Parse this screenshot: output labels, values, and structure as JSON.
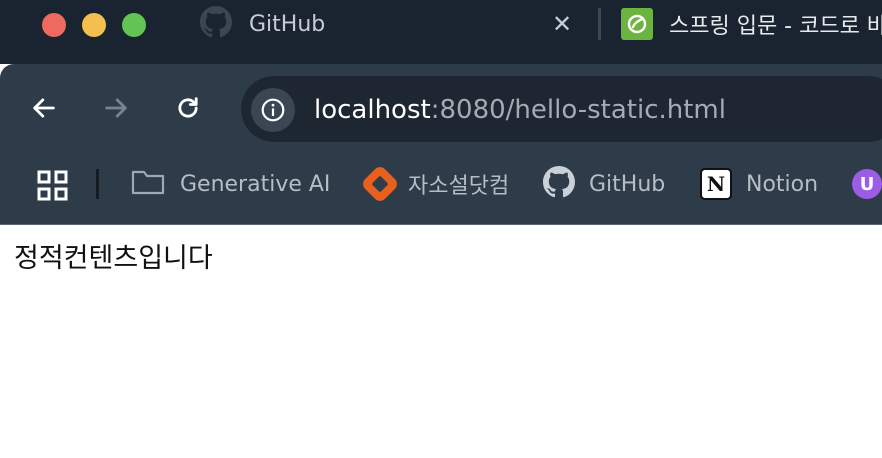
{
  "window": {
    "controls": [
      "close",
      "minimize",
      "zoom"
    ],
    "colors": {
      "tabstrip_bg": "#1a2430",
      "toolbar_bg": "#2e3b49",
      "close": "#ed6a5e",
      "minimize": "#f5bf4f",
      "zoom": "#61c454"
    }
  },
  "tabs": [
    {
      "title": "GitHub",
      "icon": "github-icon",
      "active": false
    },
    {
      "title": "스프링 입문 - 코드로 바",
      "icon": "spring-icon",
      "active": false
    }
  ],
  "tab_close_glyph": "✕",
  "address_bar": {
    "host": "localhost",
    "rest": ":8080/hello-static.html",
    "icon": "info-icon"
  },
  "bookmarks": [
    {
      "label": "Generative AI",
      "icon": "folder-icon"
    },
    {
      "label": "자소설닷컴",
      "icon": "jasoseol-icon"
    },
    {
      "label": "GitHub",
      "icon": "github-icon"
    },
    {
      "label": "Notion",
      "icon": "notion-icon"
    },
    {
      "label": "",
      "icon": "u-app-icon"
    }
  ],
  "notion_glyph": "N",
  "u_glyph": "U",
  "page": {
    "text": "정적컨텐츠입니다"
  }
}
